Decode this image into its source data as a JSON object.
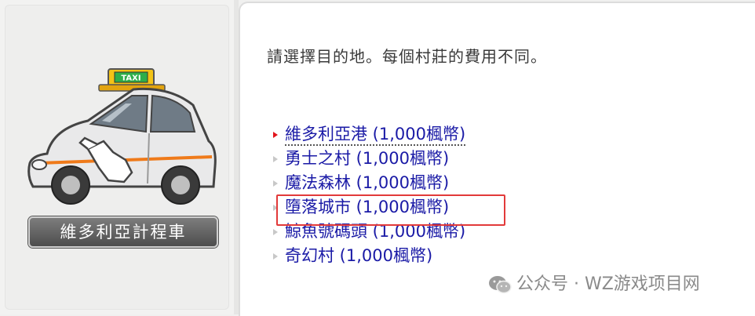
{
  "npc": {
    "name": "維多利亞計程車",
    "image": "taxi-npc"
  },
  "dialog": {
    "prompt": "請選擇目的地。每個村莊的費用不同。"
  },
  "destinations": [
    {
      "label": "維多利亞港 (1,000楓幣)",
      "selected": true
    },
    {
      "label": "勇士之村 (1,000楓幣)"
    },
    {
      "label": "魔法森林 (1,000楓幣)"
    },
    {
      "label": "墮落城市 (1,000楓幣)",
      "highlighted": true
    },
    {
      "label": "鯨魚號碼頭 (1,000楓幣)"
    },
    {
      "label": "奇幻村 (1,000楓幣)"
    }
  ],
  "watermark": {
    "text": "公众号 · WZ游戏项目网",
    "icon": "wechat-icon"
  },
  "colors": {
    "link": "#1a1aa6",
    "highlight": "#e23a3a",
    "bullet_active": "#e2141c"
  }
}
